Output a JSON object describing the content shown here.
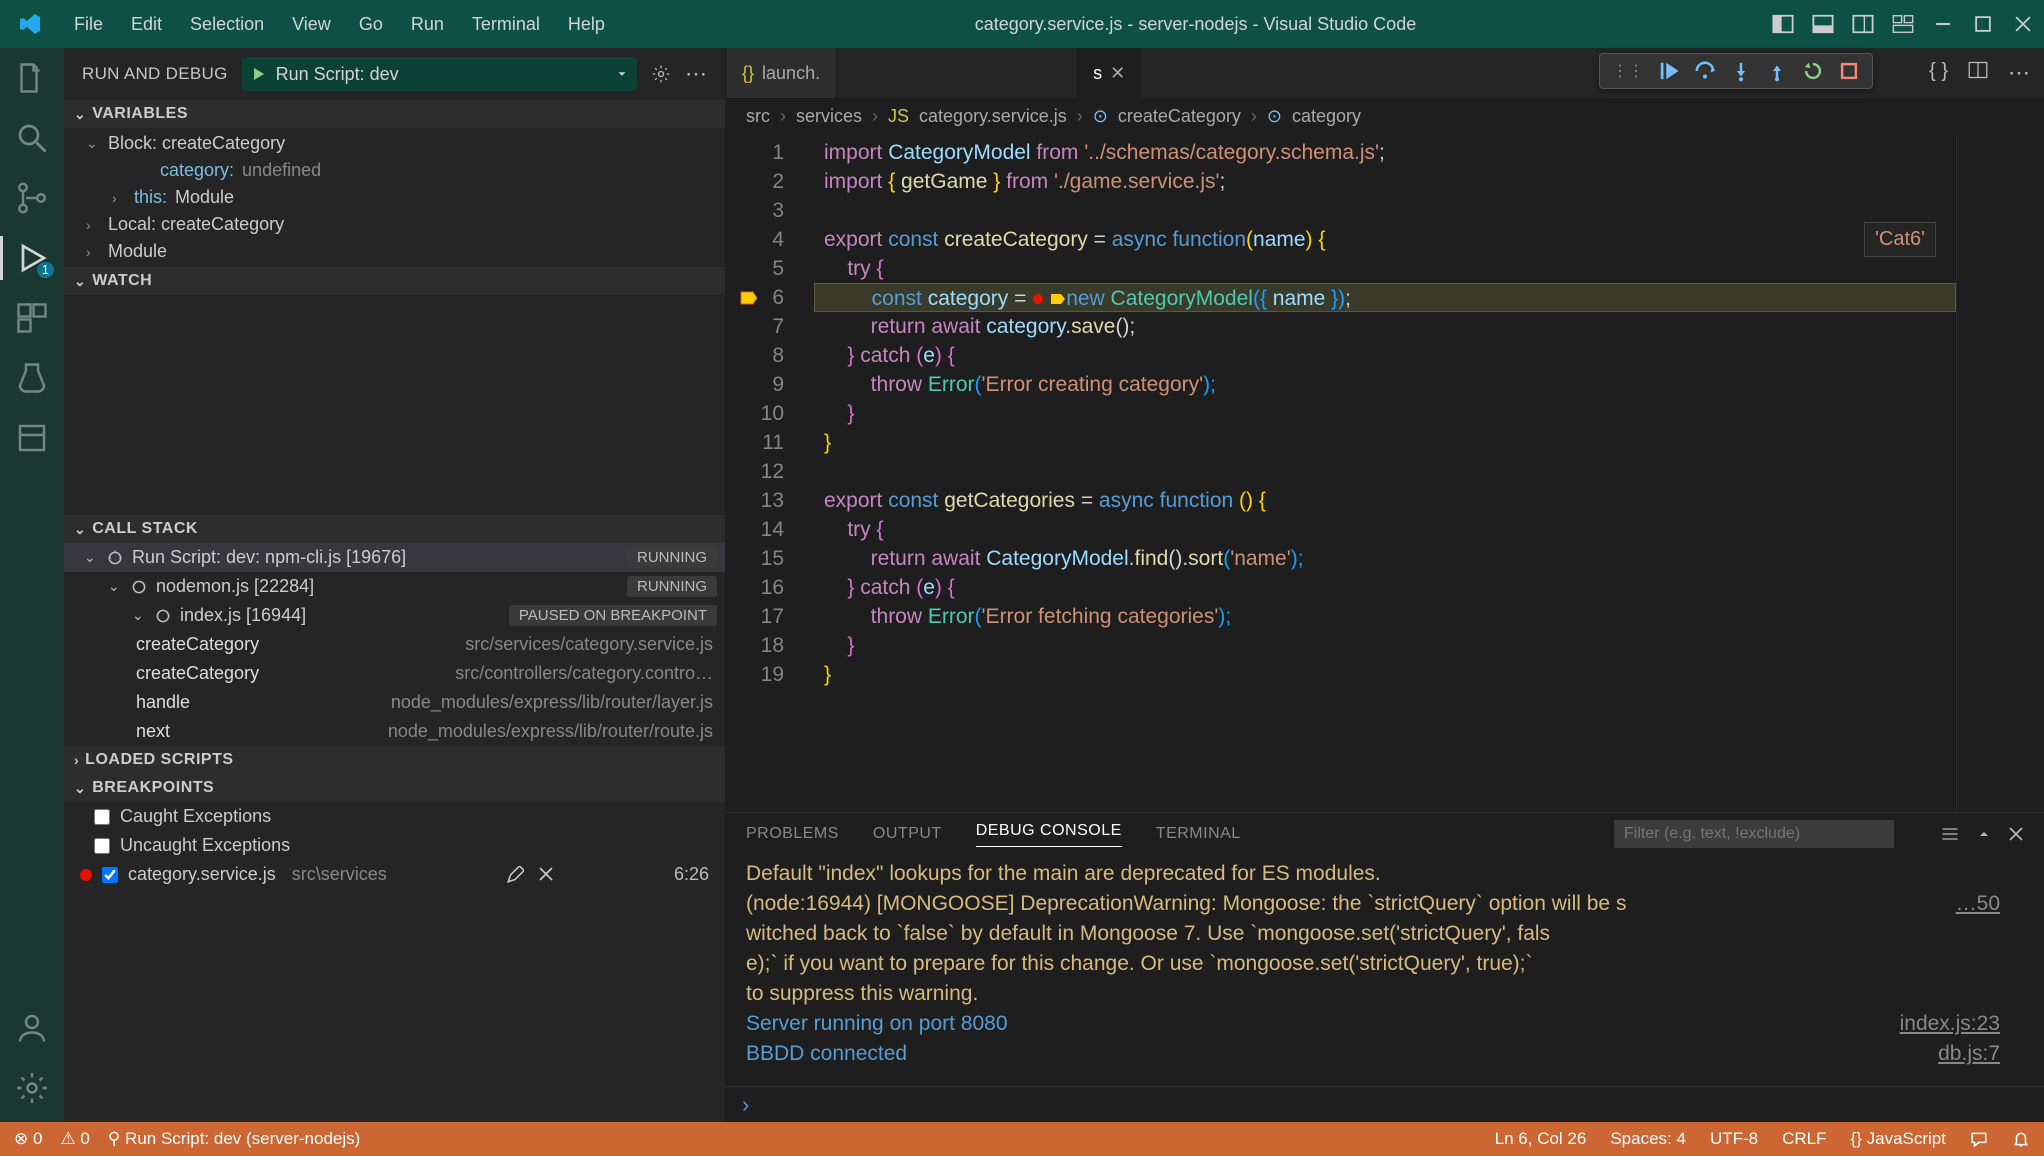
{
  "titlebar": {
    "menus": [
      "File",
      "Edit",
      "Selection",
      "View",
      "Go",
      "Run",
      "Terminal",
      "Help"
    ],
    "title": "category.service.js - server-nodejs - Visual Studio Code"
  },
  "sidebar": {
    "title": "RUN AND DEBUG",
    "run_config": "Run Script: dev",
    "sections": {
      "variables": "VARIABLES",
      "watch": "WATCH",
      "callstack": "CALL STACK",
      "loaded": "LOADED SCRIPTS",
      "breakpoints": "BREAKPOINTS"
    },
    "var_scopes": {
      "block": "Block: createCategory",
      "local": "Local: createCategory",
      "module": "Module",
      "cat_prop": "category:",
      "cat_val": "undefined",
      "this_prop": "this:",
      "this_val": "Module"
    },
    "callstack": {
      "row1": "Run Script: dev: npm-cli.js [19676]",
      "status1": "RUNNING",
      "row2": "nodemon.js [22284]",
      "status2": "RUNNING",
      "row3": "index.js [16944]",
      "status3": "PAUSED ON BREAKPOINT",
      "frames": [
        {
          "fn": "createCategory",
          "loc": "src/services/category.service.js"
        },
        {
          "fn": "createCategory",
          "loc": "src/controllers/category.contro…"
        },
        {
          "fn": "handle",
          "loc": "node_modules/express/lib/router/layer.js"
        },
        {
          "fn": "next",
          "loc": "node_modules/express/lib/router/route.js"
        }
      ]
    },
    "breakpoints": {
      "caught": "Caught Exceptions",
      "uncaught": "Uncaught Exceptions",
      "bp_file": "category.service.js",
      "bp_path": "src\\services",
      "bp_line": "6:26"
    }
  },
  "editor": {
    "tabs": [
      "launch.",
      "s"
    ],
    "breadcrumb": {
      "src": "src",
      "services": "services",
      "file": "category.service.js",
      "sym1": "createCategory",
      "sym2": "category"
    },
    "hover_hint": "'Cat6'",
    "chart_data": null,
    "code": {
      "l1_a": "import ",
      "l1_b": "CategoryModel",
      "l1_c": " from ",
      "l1_d": "'../schemas/category.schema.js'",
      "l1_e": ";",
      "l2_a": "import ",
      "l2_b": "{ ",
      "l2_c": "getGame",
      "l2_d": " }",
      "l2_e": " from ",
      "l2_f": "'./game.service.js'",
      "l2_g": ";",
      "l4_a": "export ",
      "l4_b": "const ",
      "l4_c": "createCategory",
      "l4_d": " = ",
      "l4_e": "async ",
      "l4_f": "function",
      "l4_g": "(",
      "l4_h": "name",
      "l4_i": ")",
      "l4_j": " {",
      "l5_a": "    try ",
      "l5_b": "{",
      "l6_a": "        const ",
      "l6_b": "category",
      "l6_c": " = ",
      "l6_d": "new ",
      "l6_e": "CategoryModel",
      "l6_f": "({ ",
      "l6_g": "name",
      "l6_h": " })",
      "l6_i": ";",
      "l7_a": "        return ",
      "l7_b": "await ",
      "l7_c": "category",
      "l7_d": ".",
      "l7_e": "save",
      "l7_f": "();",
      "l8_a": "    }",
      "l8_b": " catch ",
      "l8_c": "(",
      "l8_d": "e",
      "l8_e": ")",
      "l8_f": " {",
      "l9_a": "        throw ",
      "l9_b": "Error",
      "l9_c": "(",
      "l9_d": "'Error creating category'",
      "l9_e": ");",
      "l10": "    }",
      "l11": "}",
      "l13_a": "export ",
      "l13_b": "const ",
      "l13_c": "getCategories",
      "l13_d": " = ",
      "l13_e": "async ",
      "l13_f": "function ",
      "l13_g": "()",
      "l13_h": " {",
      "l14_a": "    try ",
      "l14_b": "{",
      "l15_a": "        return ",
      "l15_b": "await ",
      "l15_c": "CategoryModel",
      "l15_d": ".",
      "l15_e": "find",
      "l15_f": "().",
      "l15_g": "sort",
      "l15_h": "(",
      "l15_i": "'name'",
      "l15_j": ");",
      "l16_a": "    }",
      "l16_b": " catch ",
      "l16_c": "(",
      "l16_d": "e",
      "l16_e": ")",
      "l16_f": " {",
      "l17_a": "        throw ",
      "l17_b": "Error",
      "l17_c": "(",
      "l17_d": "'Error fetching categories'",
      "l17_e": ");",
      "l18": "    }",
      "l19": "}"
    }
  },
  "panel": {
    "tabs": [
      "PROBLEMS",
      "OUTPUT",
      "DEBUG CONSOLE",
      "TERMINAL"
    ],
    "filter_ph": "Filter (e.g. text, !exclude)",
    "lines": {
      "l1": "Default \"index\" lookups for the main are deprecated for ES modules.",
      "l2": "(node:16944) [MONGOOSE] DeprecationWarning: Mongoose: the `strictQuery` option will be s",
      "l2b": "…50",
      "l3": "witched back to `false` by default in Mongoose 7. Use `mongoose.set('strictQuery', fals",
      "l4": "e);` if you want to prepare for this change. Or use `mongoose.set('strictQuery', true);`",
      "l5": "to suppress this warning.",
      "l6": "Server running on port 8080",
      "l6_link": "index.js:23",
      "l7": "BBDD connected",
      "l7_link": "db.js:7"
    }
  },
  "statusbar": {
    "errors": "0",
    "warnings": "0",
    "debug": "Run Script: dev (server-nodejs)",
    "pos": "Ln 6, Col 26",
    "spaces": "Spaces: 4",
    "enc": "UTF-8",
    "eol": "CRLF",
    "lang": "JavaScript"
  }
}
